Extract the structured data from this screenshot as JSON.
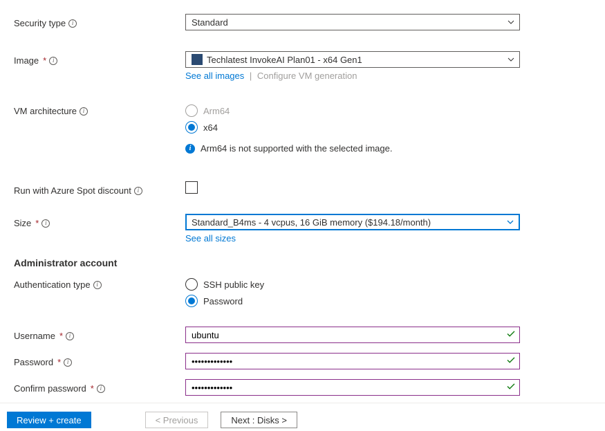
{
  "labels": {
    "security_type": "Security type",
    "image": "Image",
    "vm_arch": "VM architecture",
    "spot": "Run with Azure Spot discount",
    "size": "Size",
    "admin_section": "Administrator account",
    "auth_type": "Authentication type",
    "username": "Username",
    "password": "Password",
    "confirm_password": "Confirm password"
  },
  "values": {
    "security_type": "Standard",
    "image": "Techlatest InvokeAI Plan01 - x64 Gen1",
    "size": "Standard_B4ms - 4 vcpus, 16 GiB memory ($194.18/month)",
    "username": "ubuntu",
    "password": "•••••••••••••",
    "confirm_password": "•••••••••••••"
  },
  "sublinks": {
    "see_all_images": "See all images",
    "configure_vm_gen": "Configure VM generation",
    "see_all_sizes": "See all sizes"
  },
  "arch": {
    "arm64": "Arm64",
    "x64": "x64",
    "warning": "Arm64 is not supported with the selected image."
  },
  "auth": {
    "ssh": "SSH public key",
    "password": "Password"
  },
  "buttons": {
    "review": "Review + create",
    "previous": "< Previous",
    "next": "Next : Disks >"
  }
}
